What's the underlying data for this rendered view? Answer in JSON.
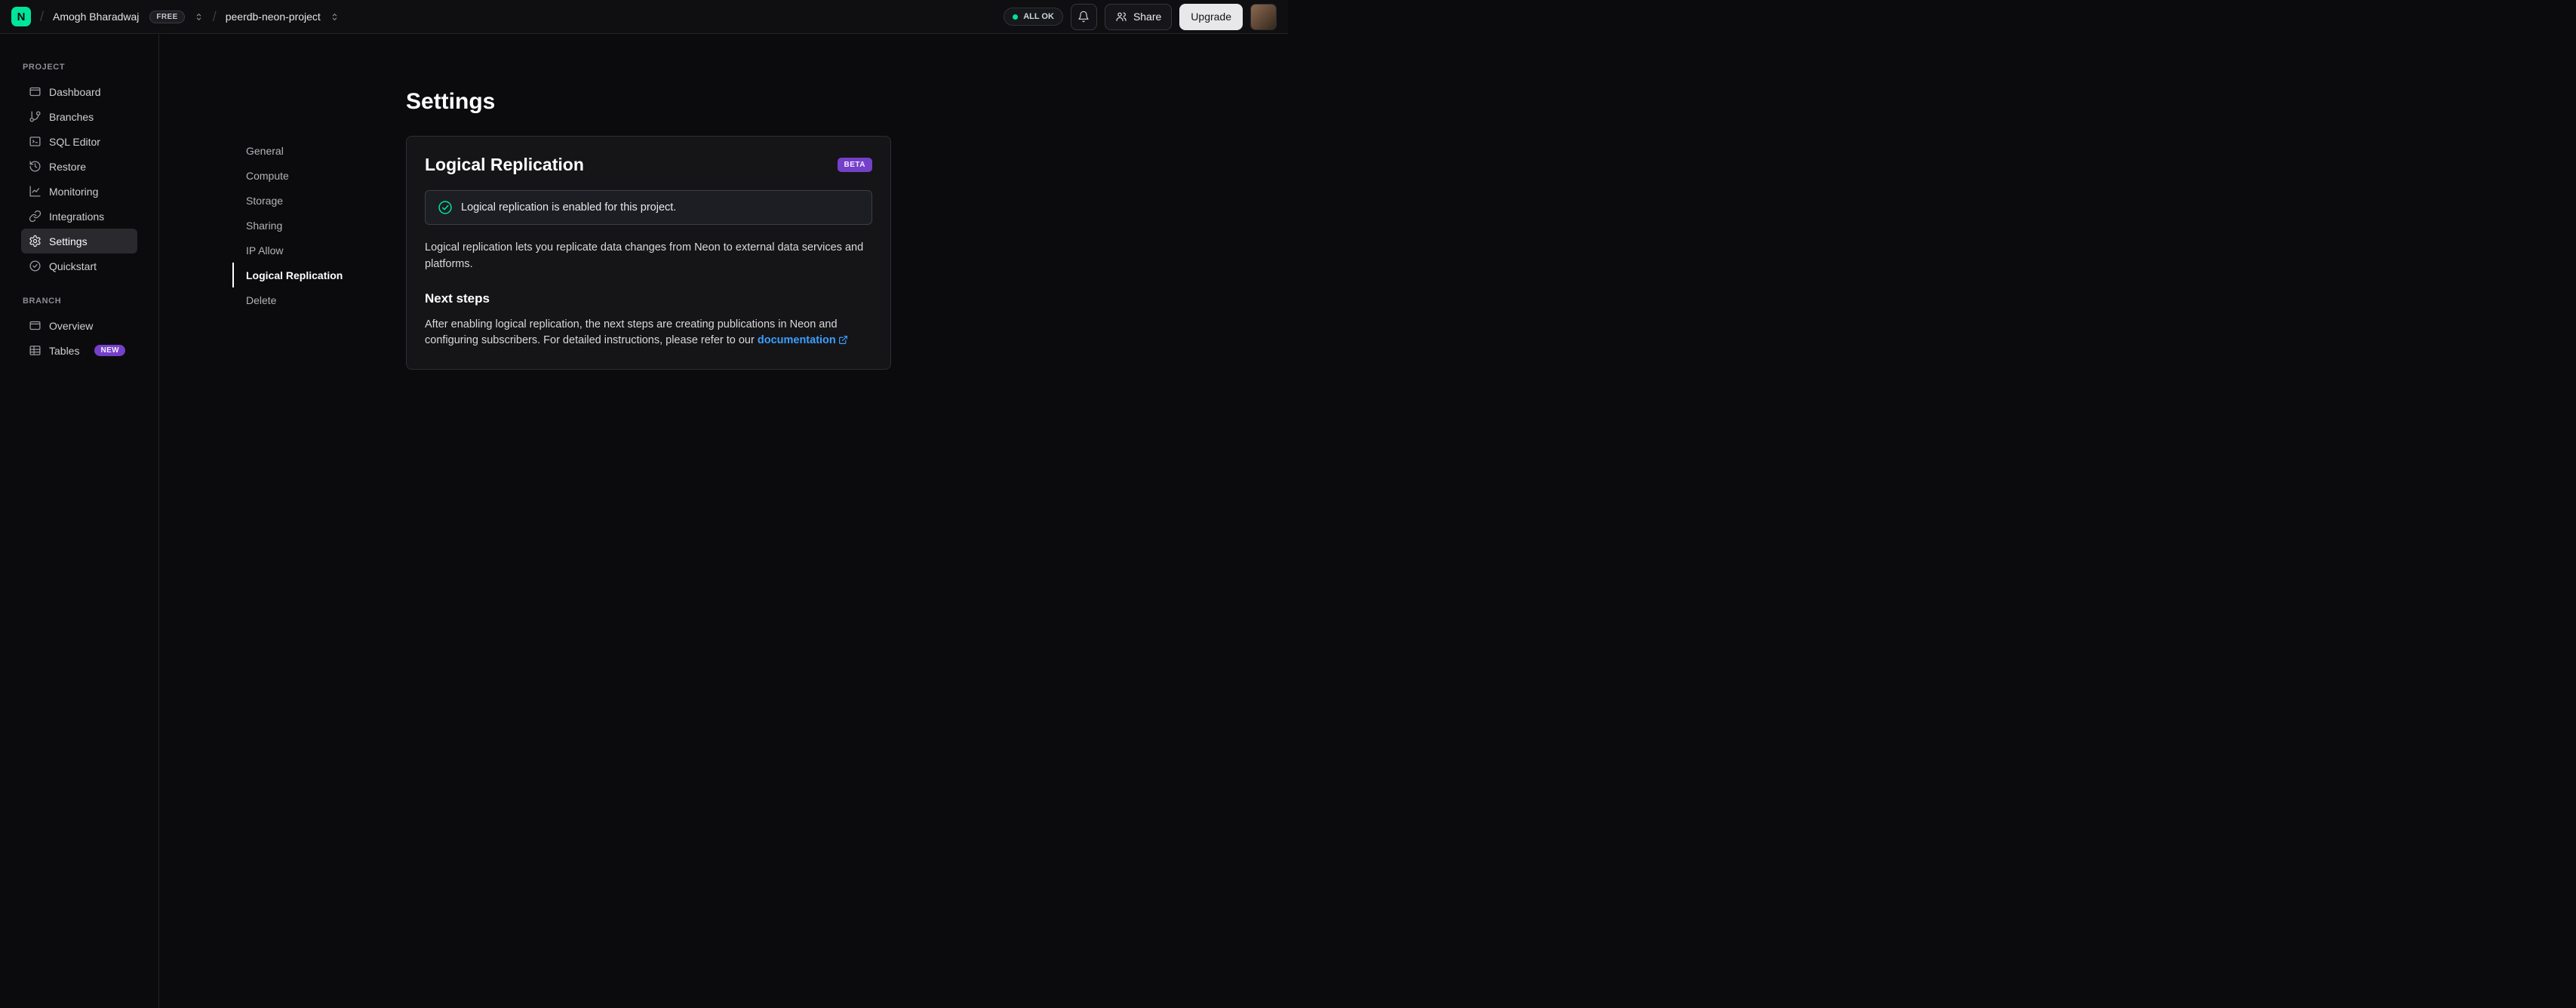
{
  "brand": {
    "logo_letter": "N"
  },
  "topbar": {
    "org_name": "Amogh Bharadwaj",
    "org_badge": "FREE",
    "project_name": "peerdb-neon-project",
    "status_label": "ALL OK",
    "share_label": "Share",
    "upgrade_label": "Upgrade"
  },
  "sidebar": {
    "sections": [
      {
        "label": "PROJECT",
        "items": [
          {
            "label": "Dashboard"
          },
          {
            "label": "Branches"
          },
          {
            "label": "SQL Editor"
          },
          {
            "label": "Restore"
          },
          {
            "label": "Monitoring"
          },
          {
            "label": "Integrations"
          },
          {
            "label": "Settings"
          },
          {
            "label": "Quickstart"
          }
        ]
      },
      {
        "label": "BRANCH",
        "items": [
          {
            "label": "Overview"
          },
          {
            "label": "Tables",
            "badge": "NEW"
          }
        ]
      }
    ]
  },
  "main": {
    "page_title": "Settings",
    "nav": {
      "items": [
        "General",
        "Compute",
        "Storage",
        "Sharing",
        "IP Allow",
        "Logical Replication",
        "Delete"
      ],
      "active": "Logical Replication"
    },
    "card": {
      "title": "Logical Replication",
      "badge": "BETA",
      "notice": "Logical replication is enabled for this project.",
      "description": "Logical replication lets you replicate data changes from Neon to external data services and platforms.",
      "next_steps_title": "Next steps",
      "next_steps_text": "After enabling logical replication, the next steps are creating publications in Neon and configuring subscribers. For detailed instructions, please refer to our ",
      "link_label": "documentation"
    }
  },
  "colors": {
    "accent_green": "#00e599",
    "badge_purple": "#7440c9",
    "link_blue": "#3b9eff"
  }
}
